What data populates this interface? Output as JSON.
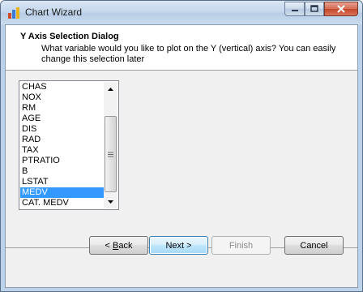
{
  "window": {
    "title": "Chart Wizard"
  },
  "header": {
    "title": "Y Axis Selection Dialog",
    "description": "What variable would you like to plot on the Y (vertical) axis? You can easily change this selection later"
  },
  "variable_list": {
    "items": [
      "CHAS",
      "NOX",
      "RM",
      "AGE",
      "DIS",
      "RAD",
      "TAX",
      "PTRATIO",
      "B",
      "LSTAT",
      "MEDV",
      "CAT. MEDV"
    ],
    "selected": "MEDV"
  },
  "buttons": {
    "back": {
      "accel": "B",
      "rest": "ack"
    },
    "next": "Next >",
    "finish": "Finish",
    "cancel": "Cancel"
  }
}
